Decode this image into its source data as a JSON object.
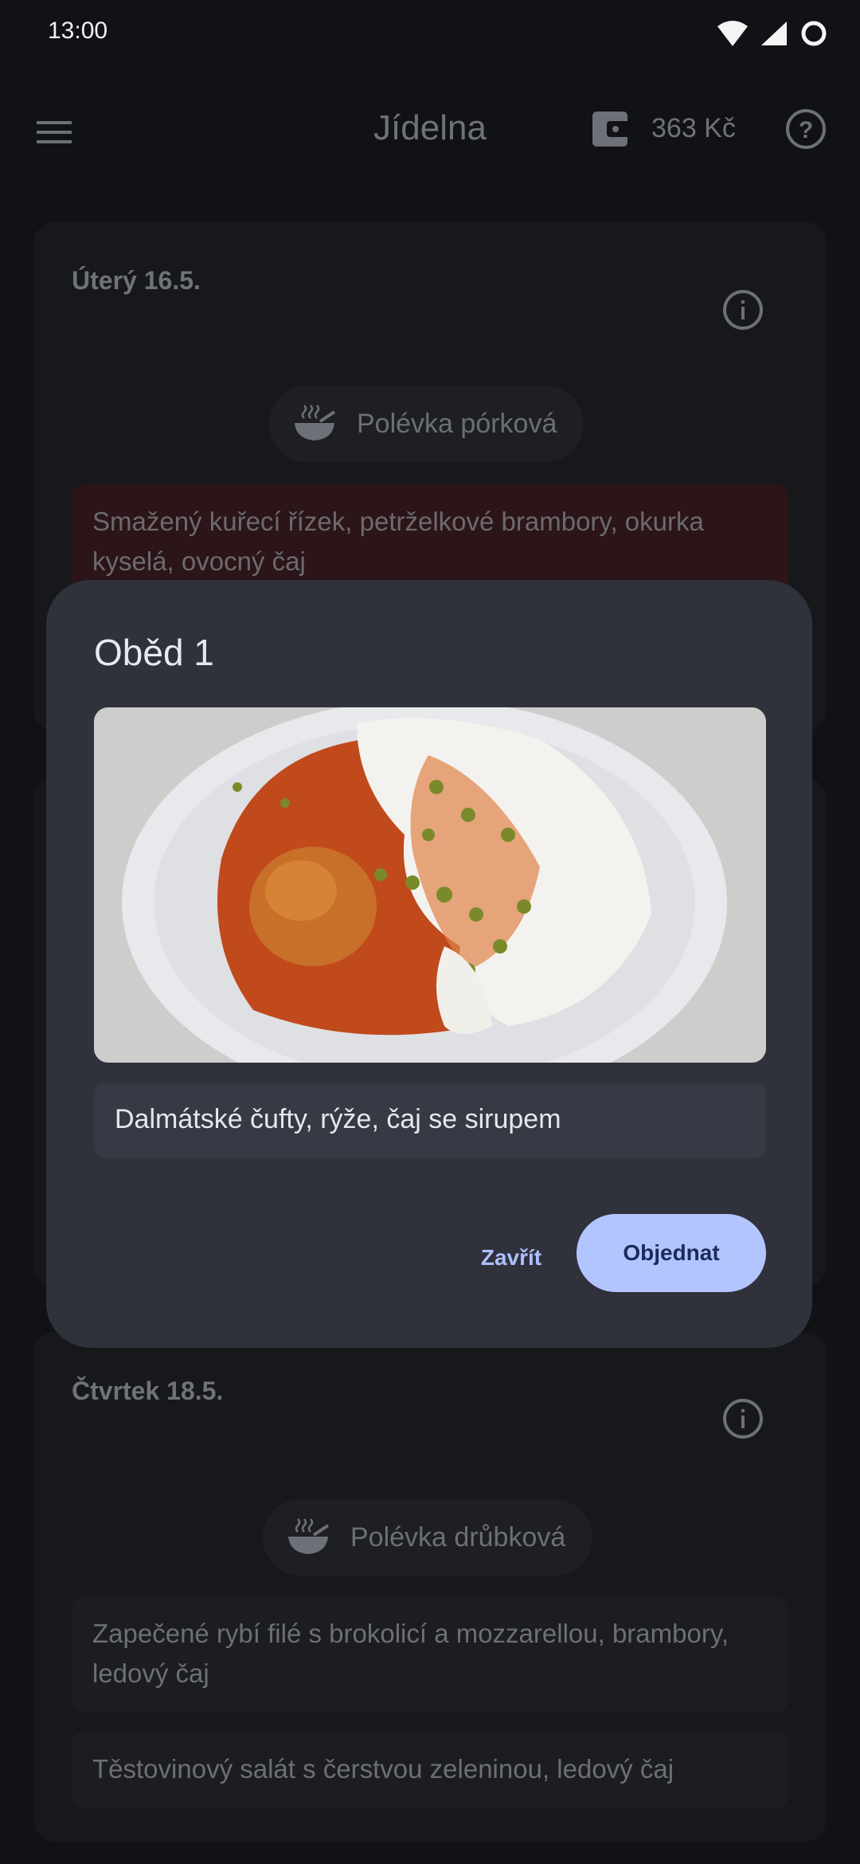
{
  "status_bar": {
    "time": "13:00"
  },
  "app_bar": {
    "title": "Jídelna",
    "balance": "363 Kč"
  },
  "days": [
    {
      "date": "Úterý 16.5.",
      "soup": "Polévka pórková",
      "meals": [
        "Smažený kuřecí řízek, petrželkové brambory, okurka kyselá, ovocný čaj"
      ]
    },
    {
      "date": "Čtvrtek 18.5.",
      "soup": "Polévka drůbková",
      "meals": [
        "Zapečené rybí filé s brokolicí a mozzarellou, brambory, ledový čaj",
        "Těstovinový salát s čerstvou zeleninou, ledový čaj"
      ]
    }
  ],
  "dialog": {
    "title": "Oběd 1",
    "description": "Dalmátské čufty, rýže, čaj se sirupem",
    "close_label": "Zavřít",
    "order_label": "Objednat"
  },
  "colors": {
    "accent": "#b3c5ff",
    "dialog_bg": "#2f313b",
    "selected_meal_bg": "#2b1518"
  }
}
